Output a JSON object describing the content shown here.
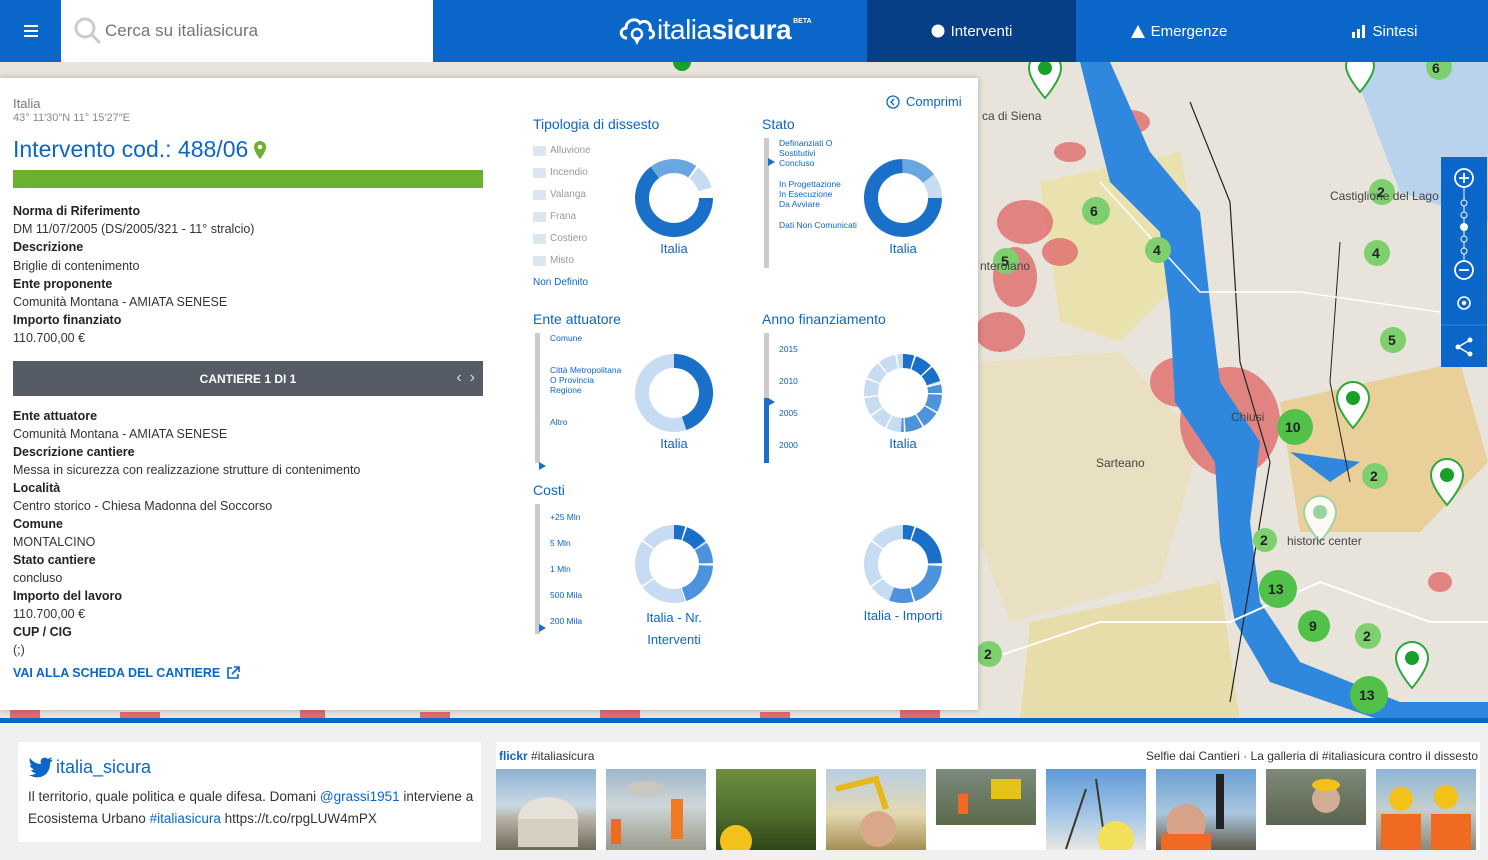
{
  "header": {
    "search_placeholder": "Cerca su italiasicura",
    "logo_part1": "italia",
    "logo_part2": "sicura",
    "logo_badge": "BETA",
    "tabs": [
      {
        "label": "Interventi",
        "active": true
      },
      {
        "label": "Emergenze",
        "active": false
      },
      {
        "label": "Sintesi",
        "active": false
      }
    ],
    "colors": {
      "primary": "#0a66c8",
      "active_tab": "#073f86",
      "progress": "#6bb12f"
    }
  },
  "panel": {
    "country": "Italia",
    "coords": "43° 11′30″N 11° 15′27″E",
    "title": "Intervento cod.: 488/06",
    "progress": 1.0,
    "collapse_label": "Comprimi",
    "fields": [
      {
        "label": "Norma di Riferimento",
        "value": "DM 11/07/2005 (DS/2005/321 - 11° stralcio)"
      },
      {
        "label": "Descrizione",
        "value": "Briglie di contenimento"
      },
      {
        "label": "Ente proponente",
        "value": "Comunità Montana - AMIATA SENESE"
      },
      {
        "label": "Importo finanziato",
        "value": "110.700,00 €"
      }
    ],
    "cantiere_bar": "CANTIERE 1 DI 1",
    "cantiere_fields": [
      {
        "label": "Ente attuatore",
        "value": "Comunità Montana - AMIATA SENESE"
      },
      {
        "label": "Descrizione cantiere",
        "value": "Messa in sicurezza con realizzazione strutture di contenimento"
      },
      {
        "label": "Località",
        "value": "Centro storico - Chiesa Madonna del Soccorso"
      },
      {
        "label": "Comune",
        "value": "MONTALCINO"
      },
      {
        "label": "Stato cantiere",
        "value": "concluso"
      },
      {
        "label": "Importo del lavoro",
        "value": "110.700,00 €"
      },
      {
        "label": "CUP / CIG",
        "value": "(;)"
      }
    ],
    "scheda_link": "VAI ALLA SCHEDA DEL CANTIERE"
  },
  "charts": {
    "tipologia": {
      "title": "Tipologia di dissesto",
      "items": [
        "Alluvione",
        "Incendio",
        "Valanga",
        "Frana",
        "Costiero",
        "Misto"
      ],
      "extra": "Non Definito",
      "label": "Italia"
    },
    "stato": {
      "title": "Stato",
      "items": [
        "Definanziati O Sostitutivi",
        "Concluso",
        "In Progettazione",
        "In Esecuzione",
        "Da Avviare",
        "Dati Non Comunicati"
      ],
      "label": "Italia"
    },
    "ente": {
      "title": "Ente attuatore",
      "items": [
        "Comune",
        "Città Metropolitana O Provincia",
        "Regione",
        "Altro"
      ],
      "label": "Italia"
    },
    "anno": {
      "title": "Anno finanziamento",
      "items": [
        "2015",
        "2010",
        "2005",
        "2000"
      ],
      "label": "Italia"
    },
    "costi": {
      "title": "Costi",
      "items": [
        "+25 Mln",
        "5 Mln",
        "1 Mln",
        "500 Mila",
        "200 Mila"
      ],
      "label_nr_1": "Italia - Nr.",
      "label_nr_2": "Interventi",
      "label_importi": "Italia - Importi"
    }
  },
  "map": {
    "labels": [
      "ca di Siena",
      "Castiglione del Lago",
      "Sarteano",
      "Chiusi",
      "historic center",
      "nteroiano"
    ],
    "clusters": [
      "6",
      "2",
      "6",
      "4",
      "4",
      "5",
      "5",
      "10",
      "2",
      "2",
      "13",
      "9",
      "2",
      "13",
      "2"
    ]
  },
  "footer": {
    "twitter_handle": "italia_sicura",
    "tweet_part1": "Il territorio, quale politica e quale difesa. Domani ",
    "tweet_mention": "@grassi1951",
    "tweet_part2": " interviene a Ecosistema Urbano ",
    "tweet_hashtag": "#italiasicura",
    "tweet_part3": " https://t.co/rpgLUW4mPX",
    "flickr_brand": "flickr",
    "flickr_tag": " #italiasicura",
    "flickr_desc": "Selfie dai Cantieri · La galleria di #italiasicura contro il dissesto"
  }
}
